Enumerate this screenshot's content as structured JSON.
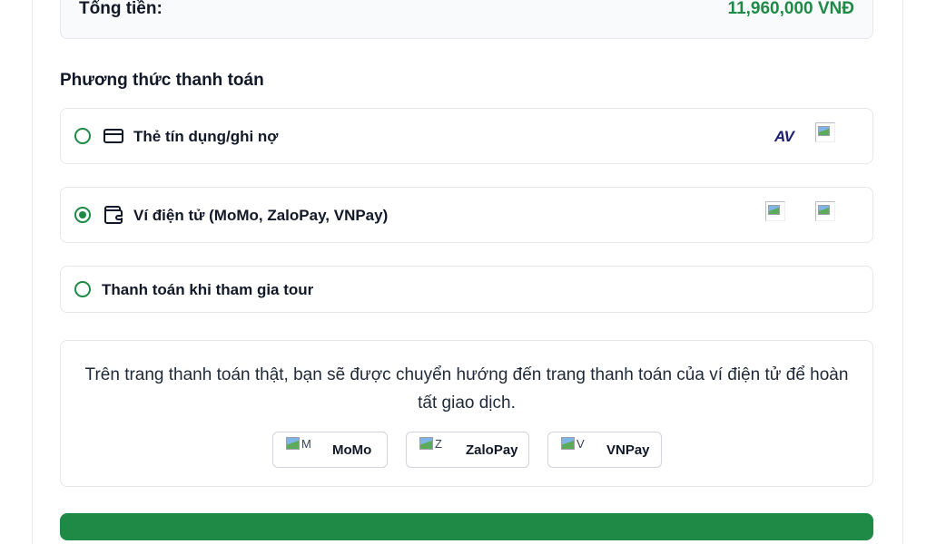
{
  "summary": {
    "total_label": "Tổng tiền:",
    "total_value": "11,960,000 VNĐ"
  },
  "payment": {
    "title": "Phương thức thanh toán",
    "methods": [
      {
        "label": "Thẻ tín dụng/ghi nợ",
        "icon": "credit-card-icon",
        "selected": false,
        "logos": [
          "AV"
        ]
      },
      {
        "label": "Ví điện tử (MoMo, ZaloPay, VNPay)",
        "icon": "wallet-icon",
        "selected": true
      },
      {
        "label": "Thanh toán khi tham gia tour",
        "selected": false
      }
    ]
  },
  "wallet_info": {
    "text": "Trên trang thanh toán thật, bạn sẽ được chuyển hướng đến trang thanh toán của ví điện tử để hoàn tất giao dịch.",
    "buttons": [
      {
        "label": "MoMo",
        "img_alt": "M"
      },
      {
        "label": "ZaloPay",
        "img_alt": "Z"
      },
      {
        "label": "VNPay",
        "img_alt": "V"
      }
    ]
  },
  "colors": {
    "accent": "#1e8a46",
    "border": "#e5e7eb",
    "total_bg": "#f9fafb"
  }
}
